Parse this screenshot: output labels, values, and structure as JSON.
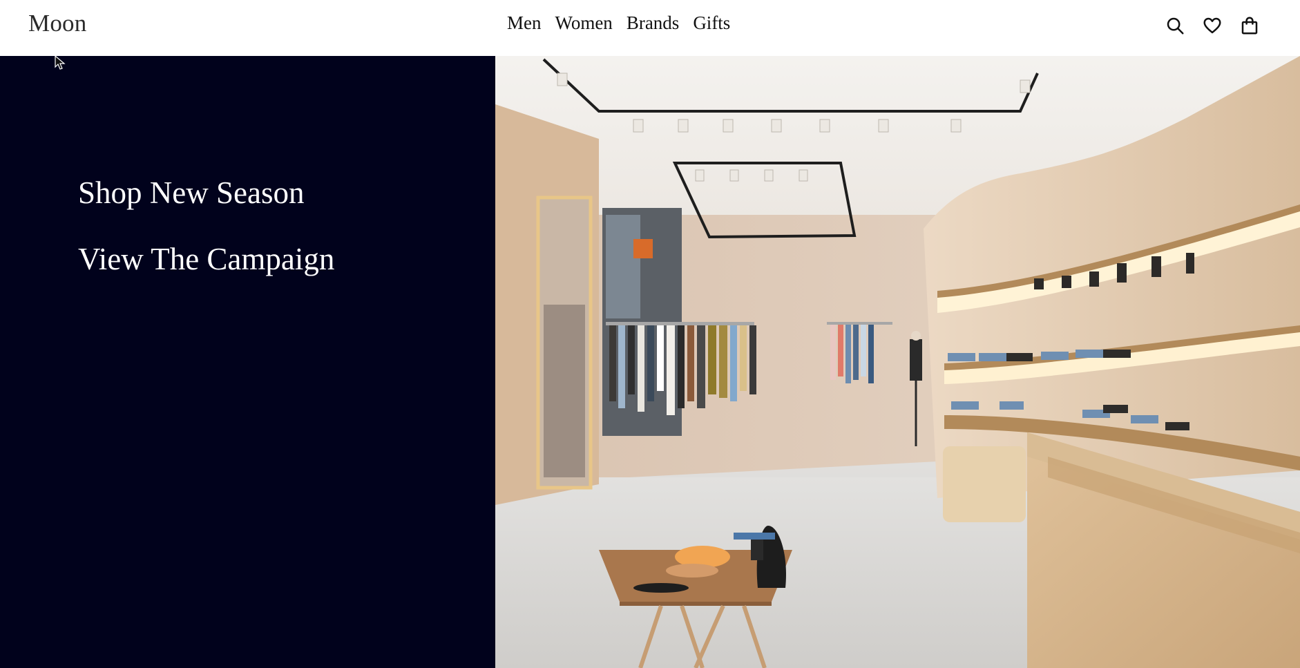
{
  "header": {
    "logo": "Moon",
    "nav": [
      {
        "label": "Men"
      },
      {
        "label": "Women"
      },
      {
        "label": "Brands"
      },
      {
        "label": "Gifts"
      }
    ],
    "icons": [
      "search-icon",
      "heart-icon",
      "shopping-bag-icon"
    ]
  },
  "hero": {
    "primary_link": "Shop New Season",
    "secondary_link": "View The Campaign",
    "image_subject": "store-interior-photo",
    "left_panel_color": "#01021c"
  }
}
